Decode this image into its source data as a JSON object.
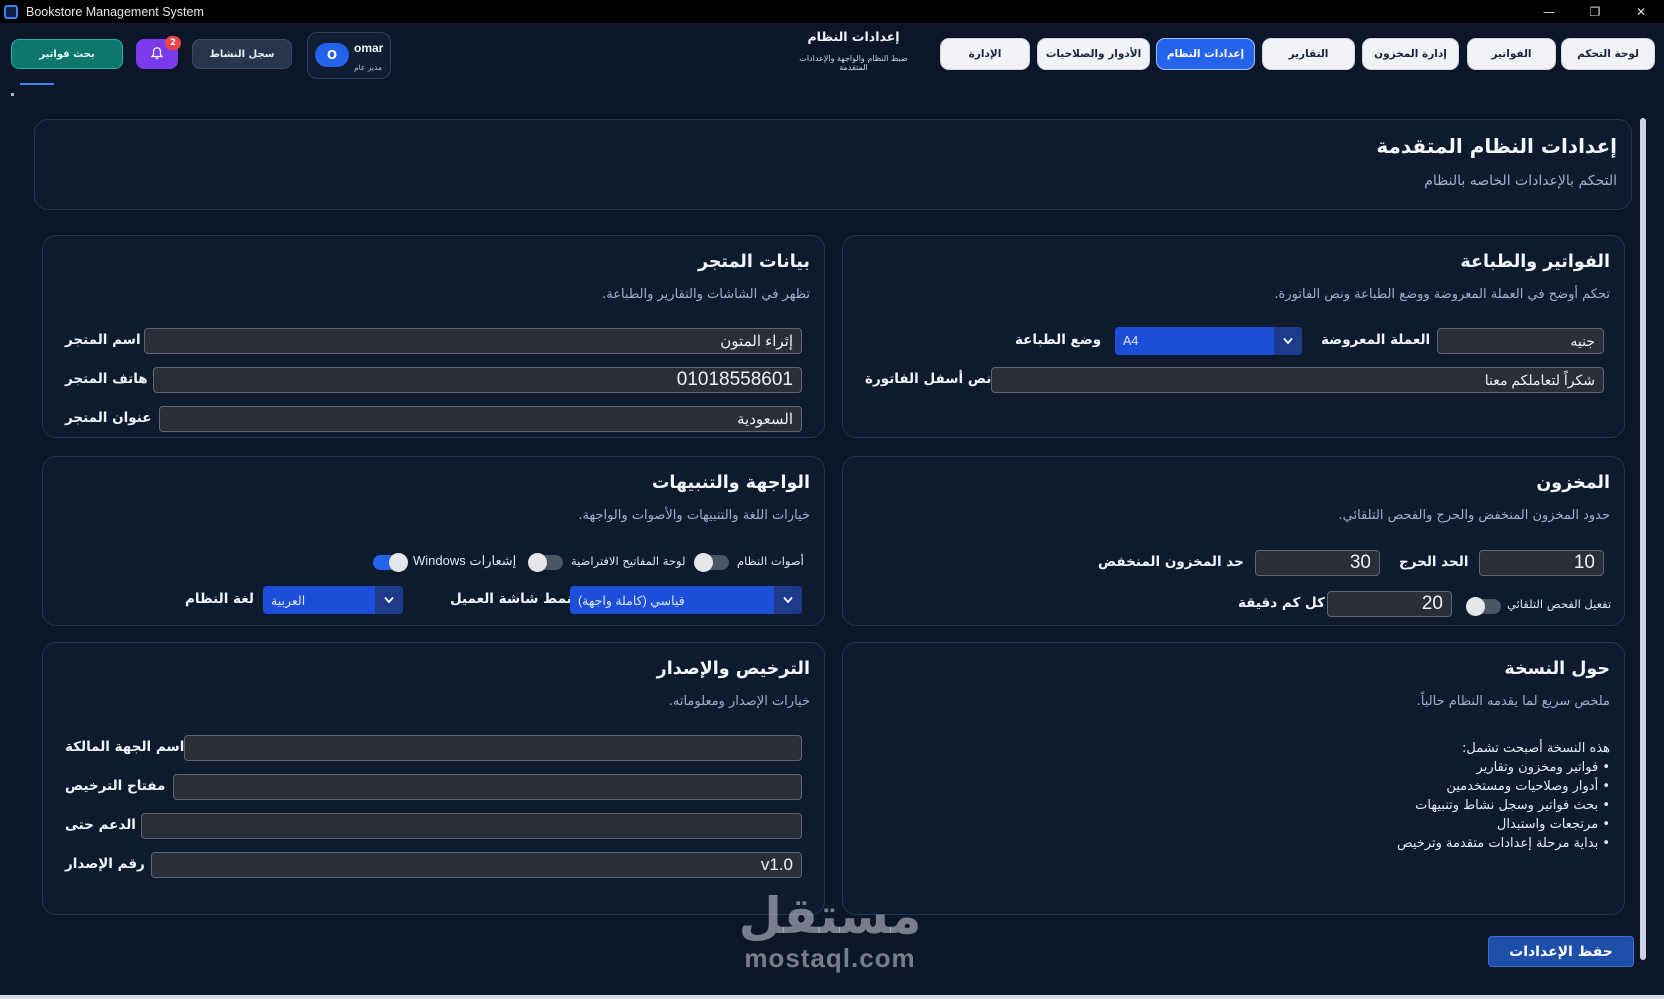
{
  "window": {
    "title": "Bookstore Management System",
    "controls": {
      "minimize": "—",
      "maximize": "❐",
      "close": "✕"
    }
  },
  "header": {
    "nav": [
      {
        "label": "لوحة التحكم",
        "active": false
      },
      {
        "label": "الفواتير",
        "active": false
      },
      {
        "label": "إدارة المخزون",
        "active": false
      },
      {
        "label": "التقارير",
        "active": false
      },
      {
        "label": "إعدادات النظام",
        "active": true
      },
      {
        "label": "الأدوار والصلاحيات",
        "active": false
      },
      {
        "label": "الإدارة",
        "active": false
      }
    ],
    "page_title": "إعدادات النظام",
    "page_subtitle": "ضبط النظام والواجهة والإعدادات المتقدمة",
    "user": {
      "avatar": "O",
      "name": "omar",
      "role": "مدير عام"
    },
    "activity_label": "سجل النشاط",
    "notifications_count": "2",
    "search_invoices_label": "بحث فواتير"
  },
  "banner": {
    "title": "إعدادات النظام المتقدمة",
    "subtitle": "التحكم بالإعدادات الخاصه بالنظام"
  },
  "invoices": {
    "title": "الفواتير والطباعة",
    "subtitle": "تحكم أوضح في العملة المعروضة ووضع الطباعة ونص الفاتورة.",
    "currency_label": "العملة المعروضة",
    "currency_value": "جنيه",
    "print_mode_label": "وضع الطباعة",
    "print_mode_value": "A4",
    "footer_label": "نص أسفل الفاتورة",
    "footer_value": "شكراً لتعاملكم معنا"
  },
  "store": {
    "title": "بيانات المتجر",
    "subtitle": "تظهر في الشاشات والتقارير والطباعة.",
    "name_label": "اسم المتجر",
    "name_value": "إثراء المتون",
    "phone_label": "هاتف المتجر",
    "phone_value": "01018558601",
    "address_label": "عنوان المتجر",
    "address_value": "السعودية"
  },
  "inventory": {
    "title": "المخزون",
    "subtitle": "حدود المخزون المنخفض والحرج والفحص التلقائي.",
    "low_label": "حد المخزون المنخفض",
    "low_value": "30",
    "critical_label": "الحد الحرج",
    "critical_value": "10",
    "auto_check_label": "تفعيل الفحص التلقائي",
    "auto_check_on": false,
    "interval_label": "كل كم دقيقة",
    "interval_value": "20"
  },
  "ui": {
    "title": "الواجهة والتنبيهات",
    "subtitle": "خيارات اللغة والتنبيهات والأصوات والواجهة.",
    "toggles": [
      {
        "label": "أصوات النظام",
        "on": false
      },
      {
        "label": "لوحة المفاتيح الافتراضية",
        "on": false
      },
      {
        "label": "إشعارات Windows",
        "on": true
      }
    ],
    "language_label": "لغة النظام",
    "language_value": "العربية",
    "display_mode_label": "نمط شاشة العميل",
    "display_mode_value": "قياسي (كاملة واجهة)"
  },
  "about": {
    "title": "حول النسخة",
    "subtitle": "ملخص سريع لما يقدمه النظام حالياً.",
    "intro": "هذه النسخة أصبحت تشمل:",
    "items": [
      "فواتير ومخزون وتقارير",
      "أدوار وصلاحيات ومستخدمين",
      "بحث فواتير وسجل نشاط وتنبيهات",
      "مرتجعات واستبدال",
      "بداية مرحلة إعدادات متقدمة وترخيص"
    ]
  },
  "license": {
    "title": "الترخيص والإصدار",
    "subtitle": "خيارات الإصدار ومعلوماته.",
    "owner_label": "اسم الجهة المالكة",
    "owner_value": "",
    "key_label": "مفتاح الترخيص",
    "key_value": "",
    "support_label": "الدعم حتى",
    "support_value": "",
    "version_label": "رقم الإصدار",
    "version_value": "v1.0"
  },
  "save_label": "حفظ الإعدادات",
  "watermark": {
    "arabic": "مستقل",
    "latin": "mostaql.com"
  },
  "colors": {
    "background": "#0c1628",
    "panel": "#0e1a2e",
    "accent": "#2563eb",
    "teal": "#0f766e",
    "purple": "#7c3aed",
    "danger": "#ef4444"
  }
}
